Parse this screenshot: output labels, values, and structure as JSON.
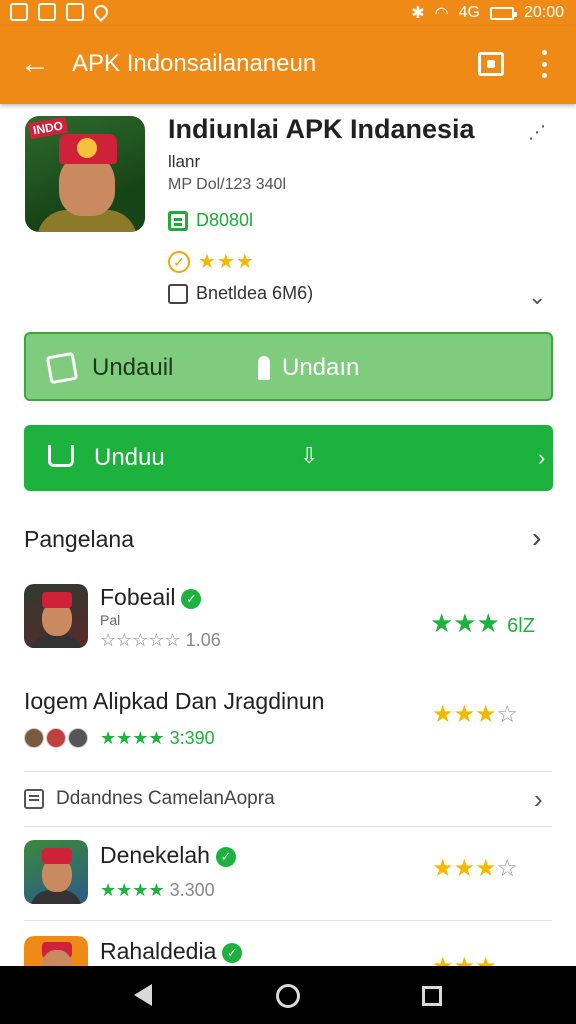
{
  "statusbar": {
    "carrier_icons": [
      "notification-icon",
      "mail-icon",
      "chat-icon",
      "location-icon"
    ],
    "right_text": "20:00",
    "signal_text": "4G"
  },
  "appbar": {
    "title": "APK Indonsailananeun"
  },
  "app": {
    "name": "Indiunlai APK Indanesia",
    "developer": "llanr",
    "meta": "MP Dol/123 340l",
    "code": "D8080l",
    "stars": "★★★",
    "size_label": "Bnetldea 6M6)",
    "icon_logo": "INDO"
  },
  "buttons": {
    "light_left": "Undauil",
    "light_right": "Undaın",
    "primary": "Unduu"
  },
  "section": {
    "title": "Pangelana"
  },
  "items": [
    {
      "title": "Fobeail",
      "sub": "Pal",
      "rating": "☆☆☆☆☆ 1.06",
      "right_stars": "★★★",
      "right_badge": "6lZ"
    },
    {
      "title": "Iogem Alipkad Dan Jragdinun",
      "rating_stars": "★★★★",
      "rating": "3:390",
      "right_stars": "★★★",
      "right_half": "☆"
    },
    {
      "title": "Denekelah",
      "rating_stars": "★★★★",
      "rating": "3.300",
      "right_stars": "★★★",
      "right_half": "☆"
    },
    {
      "title": "Rahaldedia",
      "right_stars": "★★★"
    }
  ],
  "sub_section": {
    "label": "Ddandnes CamelanAopra"
  },
  "colors": {
    "toolbar": "#ef8a17",
    "accent_green": "#1db23d",
    "star_yellow": "#f5b800"
  }
}
